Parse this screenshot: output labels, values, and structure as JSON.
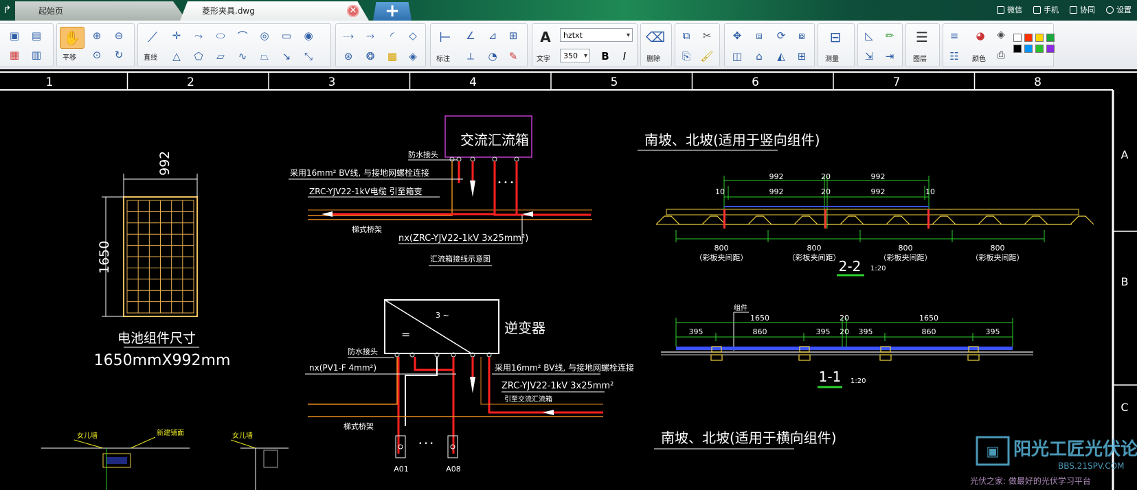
{
  "tabs": {
    "start_label": "起始页",
    "file_label": "菱形夹具.dwg",
    "close_glyph": "✕",
    "new_glyph": "+",
    "back_glyph": "↱"
  },
  "topright": [
    "微信",
    "手机",
    "协同",
    "设置"
  ],
  "toolbar": {
    "pan_label": "平移",
    "line_label": "直线",
    "dim_label": "标注",
    "text_label": "文字",
    "font_value": "hztxt",
    "size_value": "350",
    "bold": "B",
    "italic": "I",
    "delete_label": "删除",
    "measure_label": "测量",
    "layer_label": "图层",
    "color_label": "颜色",
    "text_glyph": "A"
  },
  "palette": [
    "#ffffff",
    "#ff3300",
    "#ffd400",
    "#1aa83e",
    "#000000",
    "#0095ff",
    "#2bbf2b",
    "#8a2be2"
  ],
  "drawing": {
    "ruler_cols": [
      "1",
      "2",
      "3",
      "4",
      "5",
      "6",
      "7",
      "8"
    ],
    "ruler_rows": [
      "A",
      "B",
      "C"
    ],
    "panel_size_title": "电池组件尺寸",
    "panel_size_value": "1650mmX992mm",
    "panel_w": "992",
    "panel_h": "1650",
    "combiner_box": "交流汇流箱",
    "waterproof_1": "防水接头",
    "ground_wire_1": "采用16mm² BV线, 与接地网螺栓连接",
    "cable_1": "ZRC-YJV22-1kV电缆 引至箱变",
    "tray_1": "梯式桥架",
    "nx_cable": "nx(ZRC-YJV22-1kV 3x25mm²)",
    "combiner_caption": "汇流箱接线示意图",
    "dots": "• • •",
    "inverter_label": "逆变器",
    "inv_wave": "3 ~",
    "inv_dc": "=",
    "waterproof_2": "防水接头",
    "pv_cable": "nx(PV1-F 4mm²)",
    "ground_wire_2": "采用16mm² BV线, 与接地网螺栓连接",
    "cable_2": "ZRC-YJV22-1kV 3x25mm²",
    "cable_2b": "引至交流汇流箱",
    "tray_2": "梯式桥架",
    "a01": "A01",
    "a08": "A08",
    "dots2": "• • •",
    "section_title_1": "南坡、北坡(适用于竖向组件)",
    "dim_992": "992",
    "dim_20": "20",
    "dim_10": "10",
    "dim_800": "800",
    "note_gap": "（彩板夹间距）",
    "sec_22": "2-2",
    "scale_120": "1:20",
    "label_component": "组件",
    "dim_1650": "1650",
    "dim_395": "395",
    "dim_860": "860",
    "sec_11": "1-1",
    "section_title_2": "南坡、北坡(适用于横向组件)",
    "bl_left": "女儿墙",
    "bl_mid": "新建铺面",
    "bl_right": "女儿墙"
  },
  "watermark": {
    "brand": "阳光工匠光伏论坛",
    "site": "BBS.21SPV.COM",
    "slogan": "光伏之家: 做最好的光伏学习平台"
  }
}
